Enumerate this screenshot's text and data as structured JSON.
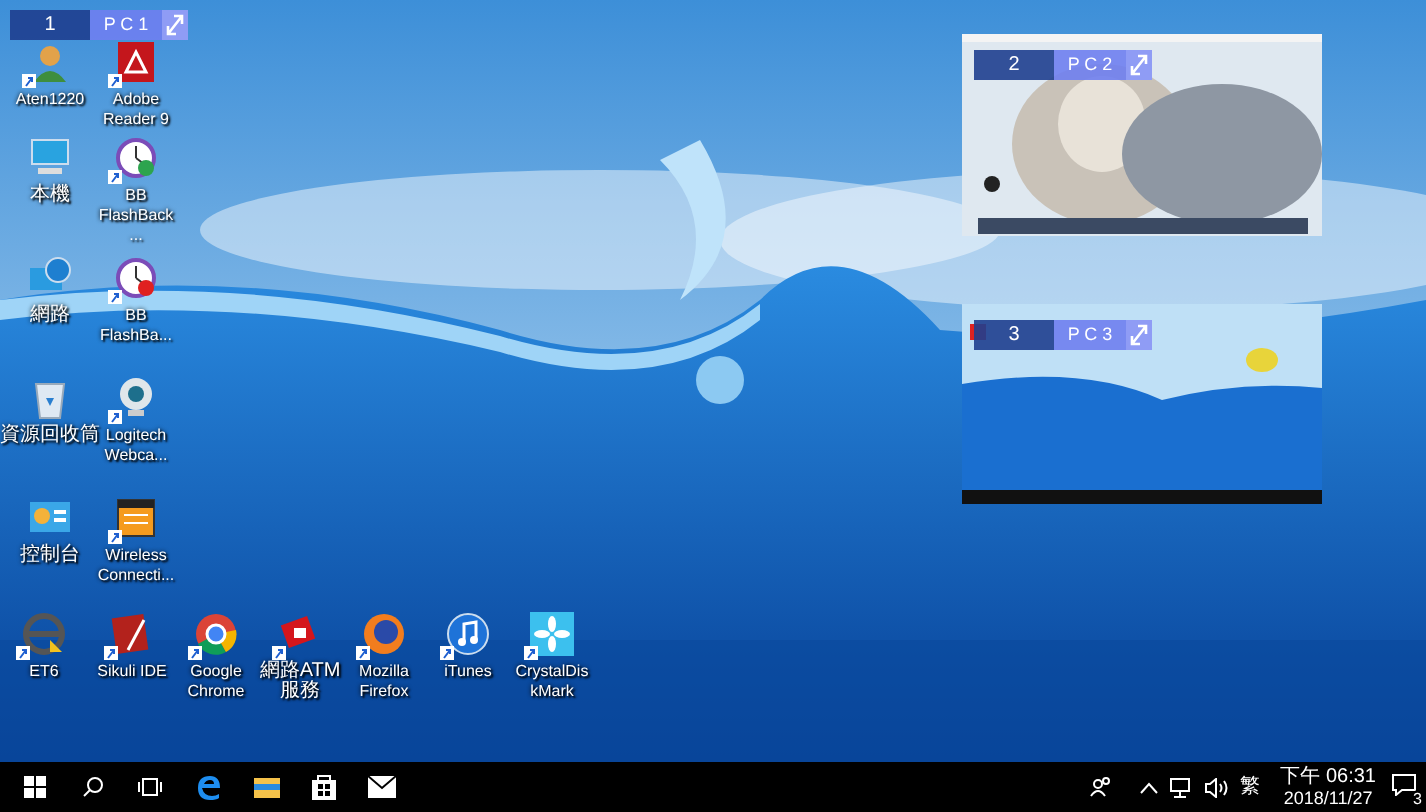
{
  "desktop_icons": [
    {
      "label": "Aten1220",
      "shortcut": true
    },
    {
      "label": "Adobe Reader 9",
      "shortcut": true
    },
    {
      "label": "本機",
      "shortcut": false
    },
    {
      "label": "BB FlashBack ...",
      "shortcut": true
    },
    {
      "label": "網路",
      "shortcut": false
    },
    {
      "label": "BB FlashBa...",
      "shortcut": true
    },
    {
      "label": "資源回收筒",
      "shortcut": false
    },
    {
      "label": "Logitech Webca...",
      "shortcut": true
    },
    {
      "label": "控制台",
      "shortcut": false
    },
    {
      "label": "Wireless Connecti...",
      "shortcut": true
    },
    {
      "label": "ET6",
      "shortcut": true
    },
    {
      "label": "Sikuli IDE",
      "shortcut": true
    },
    {
      "label": "Google Chrome",
      "shortcut": true
    },
    {
      "label": "網路ATM服務",
      "shortcut": true
    },
    {
      "label": "Mozilla Firefox",
      "shortcut": true
    },
    {
      "label": "iTunes",
      "shortcut": true
    },
    {
      "label": "CrystalDiskMark",
      "shortcut": true
    }
  ],
  "pc_switcher": [
    {
      "number": "1",
      "name": "P C 1",
      "kind": "local"
    },
    {
      "number": "2",
      "name": "P C 2",
      "kind": "snow"
    },
    {
      "number": "3",
      "name": "P C 3",
      "kind": "desktop"
    }
  ],
  "taskbar": {
    "language": "繁",
    "time": "下午 06:31",
    "date": "2018/11/27",
    "notification_count": "3"
  }
}
